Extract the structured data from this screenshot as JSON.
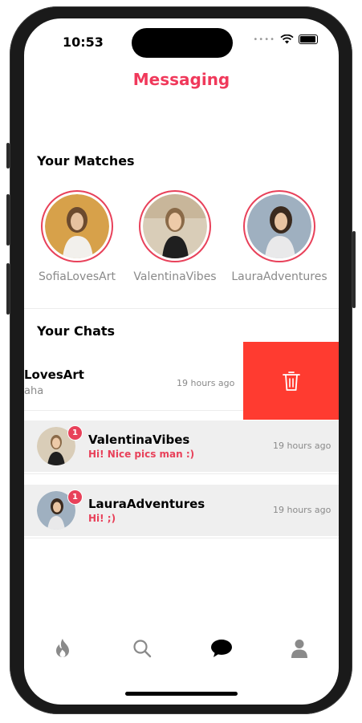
{
  "status_bar": {
    "time": "10:53",
    "signal_dots": "••••"
  },
  "header": {
    "title": "Messaging"
  },
  "matches": {
    "heading": "Your Matches",
    "items": [
      {
        "name": "SofiaLovesArt"
      },
      {
        "name": "ValentinaVibes"
      },
      {
        "name": "LauraAdventures"
      }
    ]
  },
  "chats": {
    "heading": "Your Chats",
    "items": [
      {
        "name": "LovesArt",
        "message": "aha",
        "time": "19 hours ago",
        "unread": ""
      },
      {
        "name": "ValentinaVibes",
        "message": "Hi! Nice pics man :)",
        "time": "19 hours ago",
        "unread": "1"
      },
      {
        "name": "LauraAdventures",
        "message": "Hi! ;)",
        "time": "19 hours ago",
        "unread": "1"
      }
    ]
  },
  "tabs": [
    {
      "icon": "flame-icon",
      "active": false
    },
    {
      "icon": "search-icon",
      "active": false
    },
    {
      "icon": "chat-bubble-icon",
      "active": true
    },
    {
      "icon": "profile-icon",
      "active": false
    }
  ],
  "colors": {
    "accent": "#f0395b",
    "delete": "#ff3b30",
    "tab_active": "#000000",
    "tab_inactive": "#8a8a8a"
  }
}
